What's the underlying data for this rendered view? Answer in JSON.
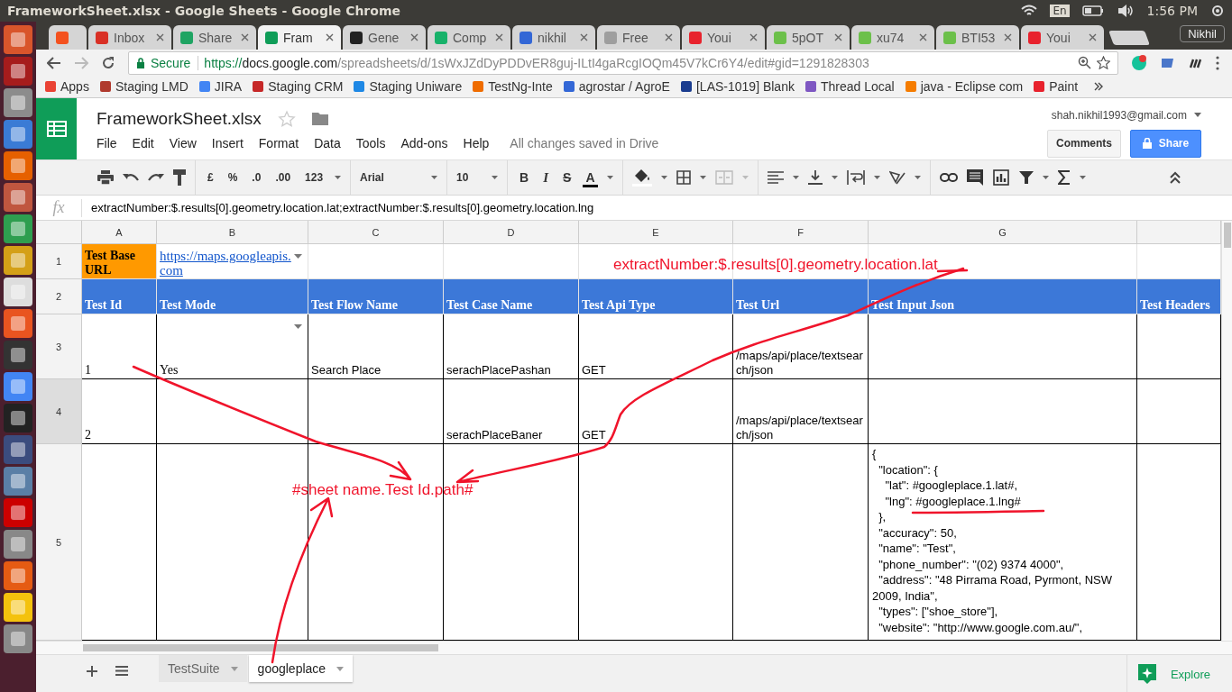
{
  "system_bar": {
    "title": "FrameworkSheet.xlsx - Google Sheets - Google Chrome",
    "keyboard": "En",
    "time": "1:56 PM"
  },
  "browser": {
    "tabs": [
      {
        "selected": false
      },
      {
        "title": "Inbox",
        "selected": false
      },
      {
        "title": "Share",
        "selected": false
      },
      {
        "title": "Fram",
        "selected": true
      },
      {
        "title": "Gene",
        "selected": false
      },
      {
        "title": "Comp",
        "selected": false
      },
      {
        "title": "nikhil",
        "selected": false
      },
      {
        "title": "Free",
        "selected": false
      },
      {
        "title": "Youi",
        "selected": false
      },
      {
        "title": "5pOT",
        "selected": false
      },
      {
        "title": "xu74",
        "selected": false
      },
      {
        "title": "BTI53",
        "selected": false
      },
      {
        "title": "Youi",
        "selected": false
      }
    ],
    "profile": "Nikhil",
    "address": {
      "secure_label": "Secure",
      "scheme": "https://",
      "host": "docs.google.com",
      "path": "/spreadsheets/d/1sWxJZdDyPDDvER8guj-ILtI4gaRcgIOQm45V7kCr6Y4/edit#gid=1291828303"
    },
    "bookmarks": [
      "Apps",
      "Staging LMD",
      "JIRA",
      "Staging CRM",
      "Staging Uniware",
      "TestNg-Inte",
      "agrostar / AgroE",
      "[LAS-1019] Blank",
      "Thread Local",
      "java - Eclipse com",
      "Paint"
    ]
  },
  "doc": {
    "title": "FrameworkSheet.xlsx",
    "menus": [
      "File",
      "Edit",
      "View",
      "Insert",
      "Format",
      "Data",
      "Tools",
      "Add-ons",
      "Help"
    ],
    "save_status": "All changes saved in Drive",
    "account": "shah.nikhil1993@gmail.com",
    "comments_button": "Comments",
    "share_button": "Share"
  },
  "toolbar": {
    "number_formats": [
      "£",
      "%",
      ".0",
      ".00",
      "123"
    ],
    "font": "Arial",
    "font_size": "10",
    "text_styles": [
      "B",
      "I",
      "S",
      "A"
    ]
  },
  "formula_bar": {
    "fx": "fx",
    "content": "extractNumber:$.results[0].geometry.location.lat;extractNumber:$.results[0].geometry.location.lng"
  },
  "grid": {
    "columns": [
      "A",
      "B",
      "C",
      "D",
      "E",
      "F",
      "G"
    ],
    "rows": [
      {
        "number": "1",
        "selected": false,
        "cells": [
          {
            "text": "Test Base URL",
            "kind": "label",
            "dropdown": false
          },
          {
            "text": "https://maps.googleapis.com",
            "kind": "link",
            "dropdown": true
          },
          null,
          null,
          null,
          null,
          null,
          null
        ]
      },
      {
        "number": "2",
        "selected": false,
        "cells": [
          {
            "text": "Test Id",
            "kind": "header",
            "dropdown": false
          },
          {
            "text": "Test Mode",
            "kind": "header",
            "dropdown": false
          },
          {
            "text": "Test Flow Name",
            "kind": "header",
            "dropdown": false
          },
          {
            "text": "Test Case Name",
            "kind": "header",
            "dropdown": false
          },
          {
            "text": "Test Api Type",
            "kind": "header",
            "dropdown": false
          },
          {
            "text": "Test Url",
            "kind": "header",
            "dropdown": false
          },
          {
            "text": "Test Input Json",
            "kind": "header",
            "dropdown": false
          },
          {
            "text": "Test Headers",
            "kind": "header",
            "dropdown": false
          }
        ]
      },
      {
        "number": "3",
        "selected": false,
        "cells": [
          {
            "text": "1",
            "kind": "serif",
            "dropdown": false
          },
          {
            "text": "Yes",
            "kind": "serif",
            "dropdown": true
          },
          {
            "text": "Search Place",
            "kind": "plain",
            "dropdown": false
          },
          {
            "text": "serachPlacePashan",
            "kind": "plain",
            "dropdown": false
          },
          {
            "text": "GET",
            "kind": "plain",
            "dropdown": false
          },
          {
            "text": "/maps/api/place/textsearch/json",
            "kind": "plain",
            "dropdown": false
          },
          null,
          null
        ]
      },
      {
        "number": "4",
        "selected": true,
        "cells": [
          {
            "text": "2",
            "kind": "serif",
            "dropdown": false
          },
          null,
          null,
          {
            "text": "serachPlaceBaner",
            "kind": "plain",
            "dropdown": false
          },
          {
            "text": "GET",
            "kind": "plain",
            "dropdown": false
          },
          {
            "text": "/maps/api/place/textsearch/json",
            "kind": "plain",
            "dropdown": false
          },
          null,
          null
        ]
      },
      {
        "number": "5",
        "selected": false,
        "cells": [
          null,
          null,
          null,
          null,
          null,
          null,
          {
            "text": "{\n  \"location\": {\n    \"lat\": #googleplace.1.lat#,\n    \"lng\": #googleplace.1.lng#\n  },\n  \"accuracy\": 50,\n  \"name\": \"Test\",\n  \"phone_number\": \"(02) 9374 4000\",\n  \"address\": \"48 Pirrama Road, Pyrmont, NSW 2009, India\",\n  \"types\": [\"shoe_store\"],\n  \"website\": \"http://www.google.com.au/\",",
            "kind": "multiline",
            "dropdown": false
          },
          null
        ]
      }
    ]
  },
  "sheet_tabs": [
    {
      "label": "TestSuite",
      "selected": false
    },
    {
      "label": "googleplace",
      "selected": true
    }
  ],
  "explore_button": "Explore",
  "annotations": [
    {
      "text": "extractNumber:$.results[0].geometry.location.lat"
    },
    {
      "text": "#sheet name.Test Id.path#"
    }
  ]
}
